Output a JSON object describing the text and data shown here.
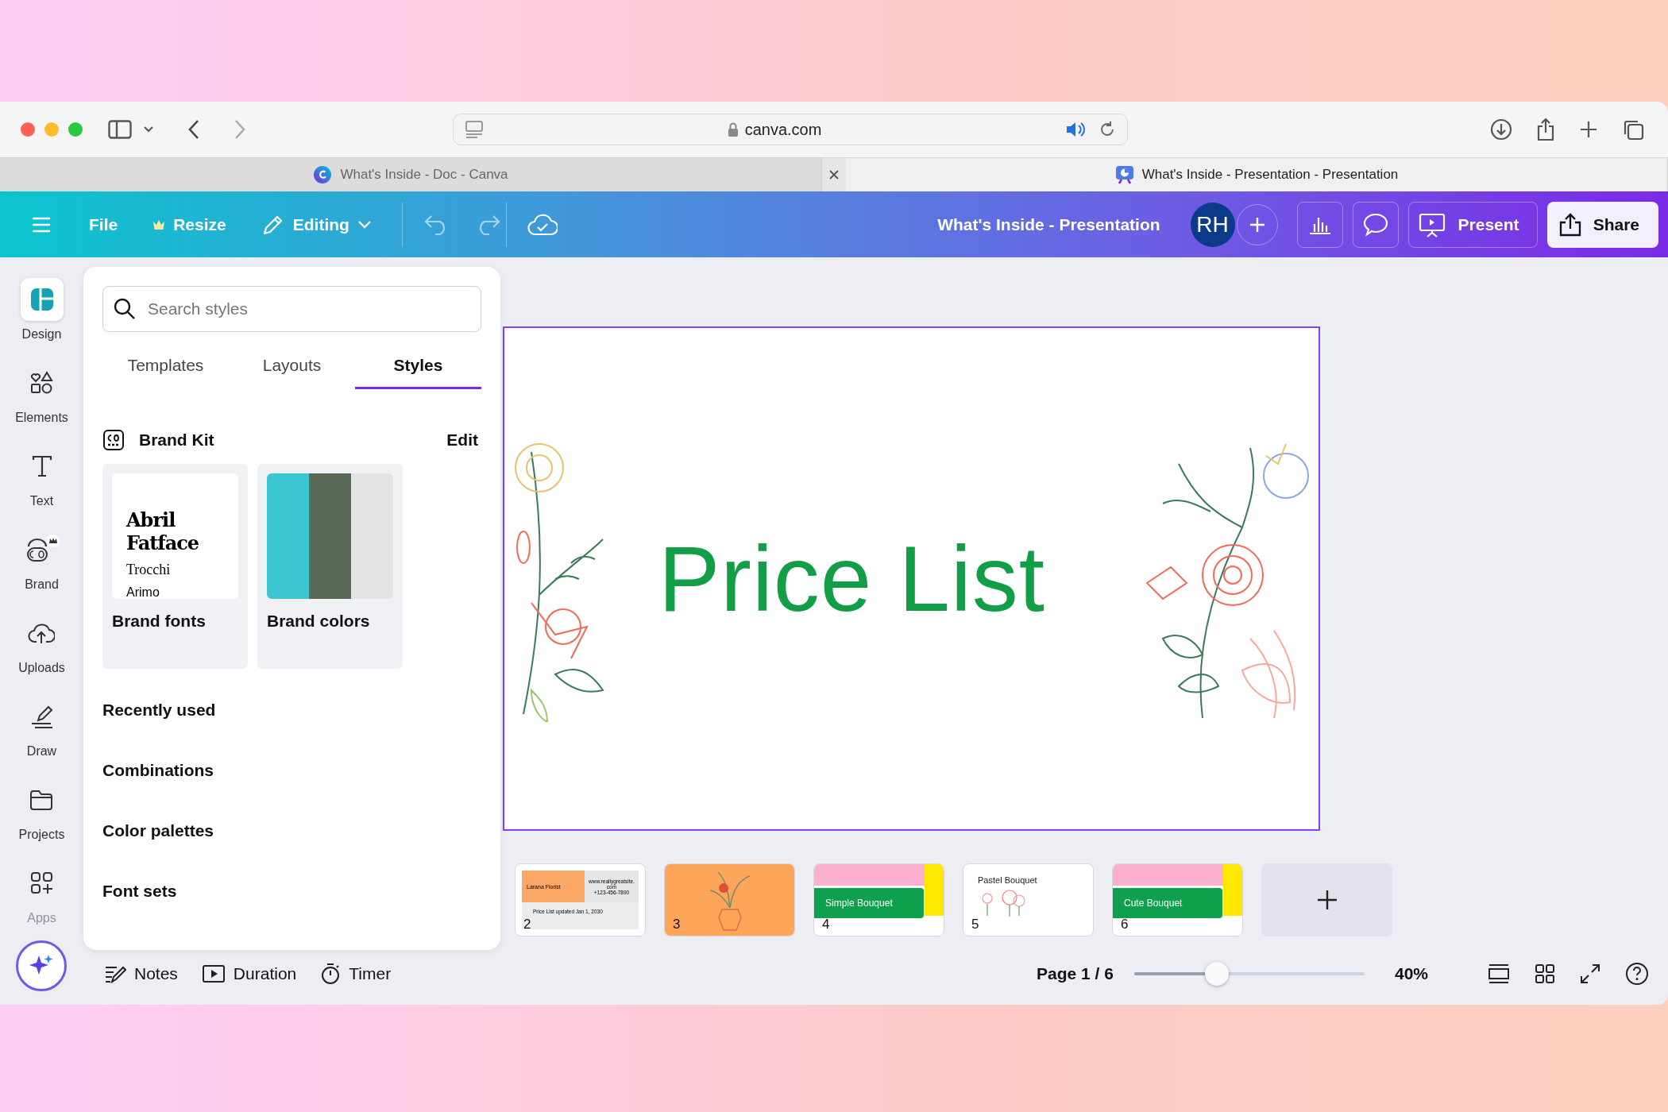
{
  "browser": {
    "url": "canva.com",
    "tabs": [
      {
        "title": "What's Inside - Doc - Canva",
        "kind": "doc",
        "selected": false
      },
      {
        "title": "What's Inside - Presentation - Presentation",
        "kind": "presentation",
        "selected": true
      }
    ]
  },
  "toolbar": {
    "menu": [
      {
        "label": "File",
        "kind": "file"
      },
      {
        "label": "Resize",
        "kind": "resize"
      },
      {
        "label": "Editing",
        "kind": "editing"
      }
    ],
    "doc_title": "What's Inside - Presentation",
    "avatar": "RH",
    "present": "Present",
    "share": "Share"
  },
  "rail": [
    {
      "label": "Design",
      "kind": "design",
      "selected": true
    },
    {
      "label": "Elements",
      "kind": "elements",
      "selected": false
    },
    {
      "label": "Text",
      "kind": "text",
      "selected": false
    },
    {
      "label": "Brand",
      "kind": "brand",
      "selected": false
    },
    {
      "label": "Uploads",
      "kind": "uploads",
      "selected": false
    },
    {
      "label": "Draw",
      "kind": "draw",
      "selected": false
    },
    {
      "label": "Projects",
      "kind": "projects",
      "selected": false
    },
    {
      "label": "Apps",
      "kind": "apps",
      "selected": false
    }
  ],
  "panel": {
    "search": {
      "placeholder": "Search styles"
    },
    "tabs": [
      {
        "label": "Templates",
        "selected": false
      },
      {
        "label": "Layouts",
        "selected": false
      },
      {
        "label": "Styles",
        "selected": true
      }
    ],
    "brand_kit": {
      "title": "Brand Kit",
      "edit": "Edit",
      "fonts_card": {
        "fonts": [
          "Abril Fatface",
          "Trocchi",
          "Arimo"
        ],
        "label": "Brand fonts"
      },
      "colors_card": {
        "label": "Brand colors"
      }
    },
    "sections": [
      "Recently used",
      "Combinations",
      "Color palettes",
      "Font sets"
    ]
  },
  "slide": {
    "title": "Price List"
  },
  "thumbnails": [
    {
      "kind": "contact",
      "number": "2",
      "texts": [
        "Larana Florist",
        "www.reallygreatsite.com",
        "+123-456-7890",
        "Price List updated Jan 1, 2030"
      ]
    },
    {
      "kind": "vase",
      "number": "3"
    },
    {
      "kind": "banner",
      "number": "4",
      "texts": [
        "Simple Bouquet"
      ]
    },
    {
      "kind": "flowers",
      "number": "5",
      "texts": [
        "Pastel Bouquet"
      ]
    },
    {
      "kind": "banner",
      "number": "6",
      "texts": [
        "Cute Bouquet"
      ]
    }
  ],
  "footer": {
    "buttons": [
      {
        "label": "Notes",
        "kind": "notes"
      },
      {
        "label": "Duration",
        "kind": "duration"
      },
      {
        "label": "Timer",
        "kind": "timer"
      }
    ],
    "page": "Page 1 / 6",
    "zoom": {
      "level": 0.36,
      "reading": "40%"
    }
  }
}
